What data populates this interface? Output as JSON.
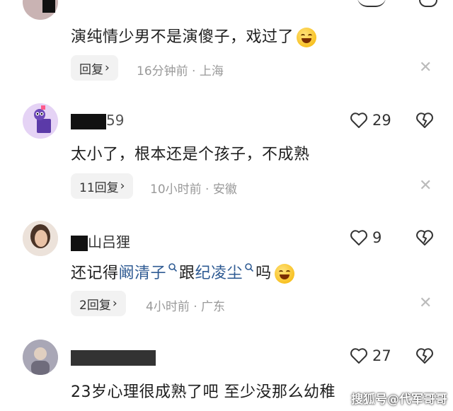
{
  "comments": [
    {
      "username": "",
      "like_count": "",
      "text_parts": [
        "演纯情少男不是演傻子，戏过了"
      ],
      "reply_label": "回复",
      "time": "16分钟前",
      "location": "上海"
    },
    {
      "username": "59",
      "like_count": "29",
      "text_parts": [
        "太小了，根本还是个孩子，不成熟"
      ],
      "reply_label": "11回复",
      "time": "10小时前",
      "location": "安徽"
    },
    {
      "username": "山吕狸",
      "like_count": "9",
      "text_parts": [
        "还记得",
        "阚清子",
        "跟",
        "纪凌尘",
        "吗"
      ],
      "reply_label": "2回复",
      "time": "4小时前",
      "location": "广东"
    },
    {
      "username": "",
      "like_count": "27",
      "text_parts": [
        "23岁心理很成熟了吧 至少没那么幼稚"
      ]
    }
  ],
  "meta_separator": "·",
  "colors": {
    "link": "#2f5b93",
    "meta": "#999999",
    "reply_bg": "#f2f2f2"
  },
  "icons": [
    "heart-icon",
    "dislike-icon",
    "chevron-right-icon",
    "close-icon",
    "search-icon",
    "laughing-emoji",
    "smiling-emoji"
  ],
  "watermark": "搜狐号@代军哥哥"
}
